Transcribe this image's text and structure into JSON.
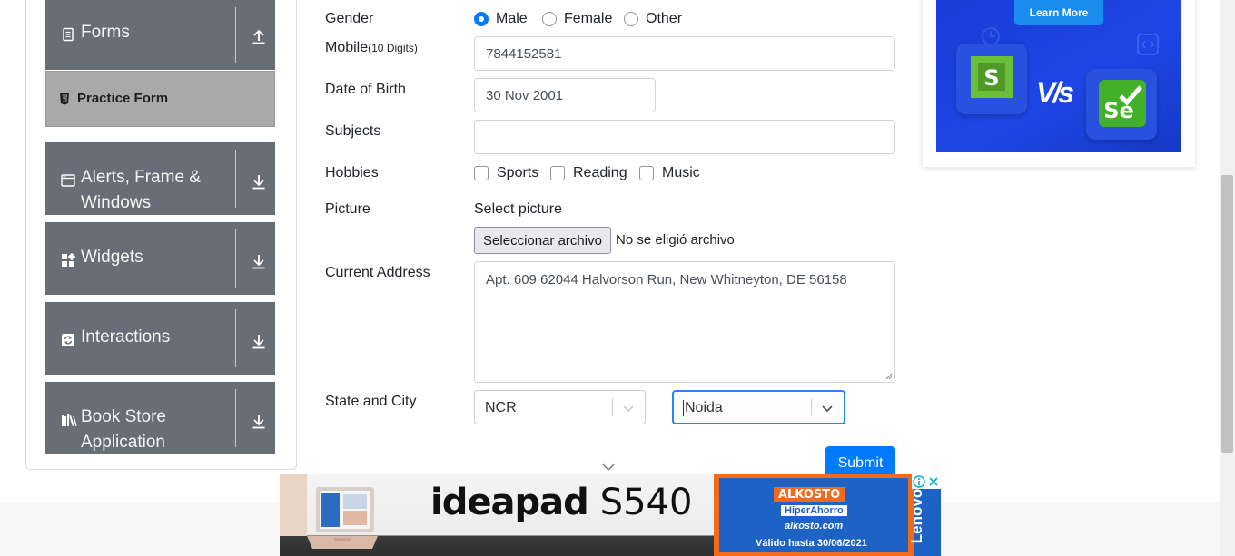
{
  "sidebar": {
    "groups": [
      {
        "label": "Forms",
        "icon": "document-icon",
        "state": "expanded"
      },
      {
        "label": "Alerts, Frame & Windows",
        "icon": "window-icon",
        "state": "collapsed"
      },
      {
        "label": "Widgets",
        "icon": "widgets-icon",
        "state": "collapsed"
      },
      {
        "label": "Interactions",
        "icon": "interactions-icon",
        "state": "collapsed"
      },
      {
        "label": "Book Store Application",
        "icon": "books-icon",
        "state": "collapsed"
      }
    ],
    "active_item": {
      "label": "Practice Form",
      "icon": "html5-icon"
    }
  },
  "form": {
    "gender": {
      "label": "Gender",
      "options": [
        "Male",
        "Female",
        "Other"
      ],
      "selected": "Male"
    },
    "mobile": {
      "label": "Mobile",
      "hint": "(10 Digits)",
      "value": "7844152581"
    },
    "dob": {
      "label": "Date of Birth",
      "value": "30 Nov 2001"
    },
    "subjects": {
      "label": "Subjects",
      "value": ""
    },
    "hobbies": {
      "label": "Hobbies",
      "options": [
        "Sports",
        "Reading",
        "Music"
      ],
      "checked": []
    },
    "picture": {
      "label": "Picture",
      "caption": "Select picture",
      "button": "Seleccionar archivo",
      "status": "No se eligió archivo"
    },
    "address": {
      "label": "Current Address",
      "value": "Apt. 609 62044 Halvorson Run, New Whitneyton, DE 56158"
    },
    "state_city": {
      "label": "State and City",
      "state": "NCR",
      "city": "Noida"
    },
    "submit": "Submit"
  },
  "ads": {
    "right": {
      "button": "Learn More",
      "vs": "V/s",
      "tiles": [
        "Katalon logo",
        "Selenium logo"
      ]
    },
    "bottom": {
      "brand_word": "ideapad",
      "model": "S540",
      "store": "ALKOSTO",
      "store_tagline": "HiperAhorro",
      "store_url": "alkosto.com",
      "valid_until": "Válido hasta 30/06/2021",
      "vendor": "Lenovo"
    }
  },
  "colors": {
    "sidebar_group": "#686e76",
    "active_item": "#a9a9a9",
    "primary": "#007bff",
    "focus_border": "#2684ff",
    "ad_blue": "#1e46e6"
  }
}
